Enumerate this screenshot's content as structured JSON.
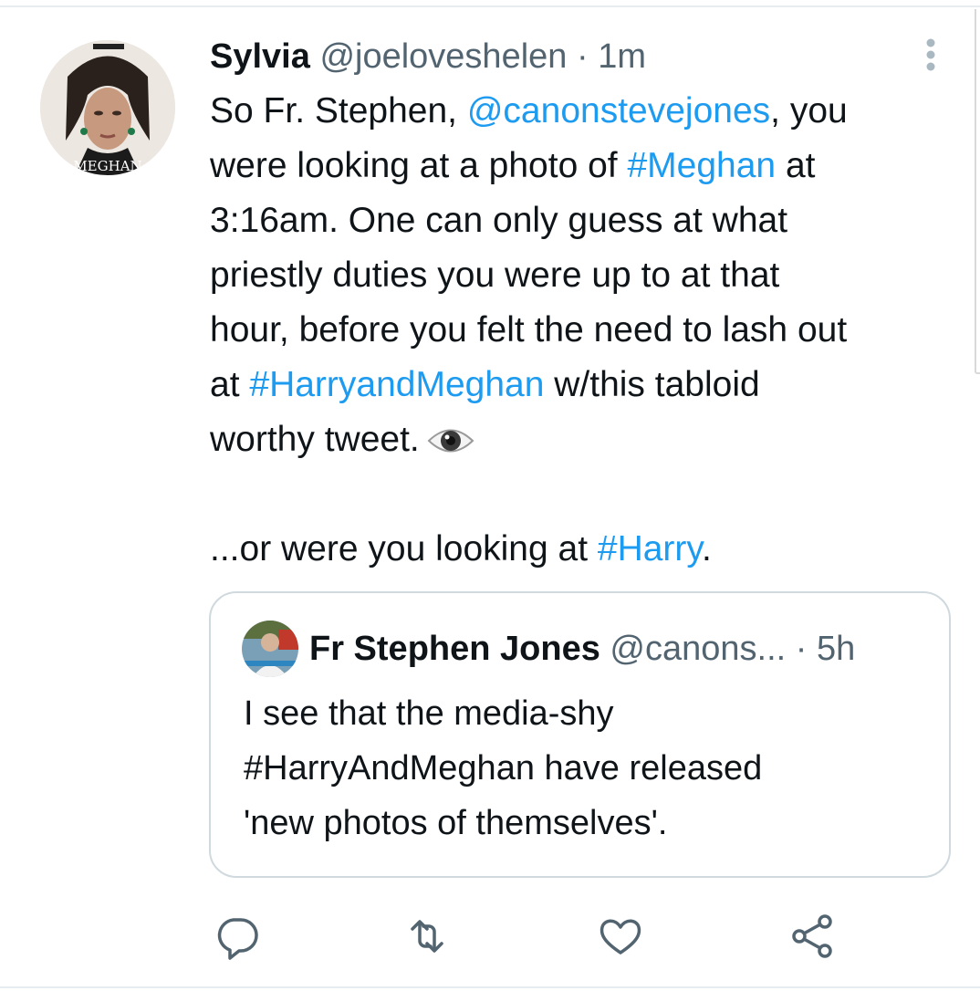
{
  "tweet": {
    "display_name": "Sylvia",
    "handle": "@joeloveshelen",
    "separator": "·",
    "time": "1m",
    "avatar_caption": "MEGHAN",
    "text_lines": [
      [
        {
          "t": "So Fr. Stephen, ",
          "link": false
        },
        {
          "t": "@canonstevejones",
          "link": true
        },
        {
          "t": ", you",
          "link": false
        }
      ],
      [
        {
          "t": "were looking at a photo of ",
          "link": false
        },
        {
          "t": "#Meghan",
          "link": true
        },
        {
          "t": " at",
          "link": false
        }
      ],
      [
        {
          "t": "3:16am. One can only guess at what",
          "link": false
        }
      ],
      [
        {
          "t": "priestly duties you were up to at that",
          "link": false
        }
      ],
      [
        {
          "t": "hour, before you felt the need to lash out",
          "link": false
        }
      ],
      [
        {
          "t": "at ",
          "link": false
        },
        {
          "t": "#HarryandMeghan",
          "link": true
        },
        {
          "t": " w/this tabloid",
          "link": false
        }
      ],
      [
        {
          "t": "worthy tweet.",
          "link": false
        }
      ],
      [],
      [
        {
          "t": "...or were you looking at ",
          "link": false
        },
        {
          "t": "#Harry",
          "link": true
        },
        {
          "t": ".",
          "link": false
        }
      ]
    ],
    "emoji": "eye-emoji"
  },
  "quoted_tweet": {
    "display_name": "Fr Stephen Jones",
    "handle": "@canons...",
    "separator": "·",
    "time": "5h",
    "text_lines": [
      "I see that the media-shy",
      "#HarryAndMeghan have released",
      "'new photos of themselves'."
    ]
  },
  "actions": [
    {
      "name": "reply-icon"
    },
    {
      "name": "retweet-icon"
    },
    {
      "name": "like-icon"
    },
    {
      "name": "share-icon"
    }
  ],
  "colors": {
    "link": "#1d9bf0",
    "secondary_text": "#536471",
    "primary_text": "#0f1419",
    "border": "#cfd9de"
  }
}
